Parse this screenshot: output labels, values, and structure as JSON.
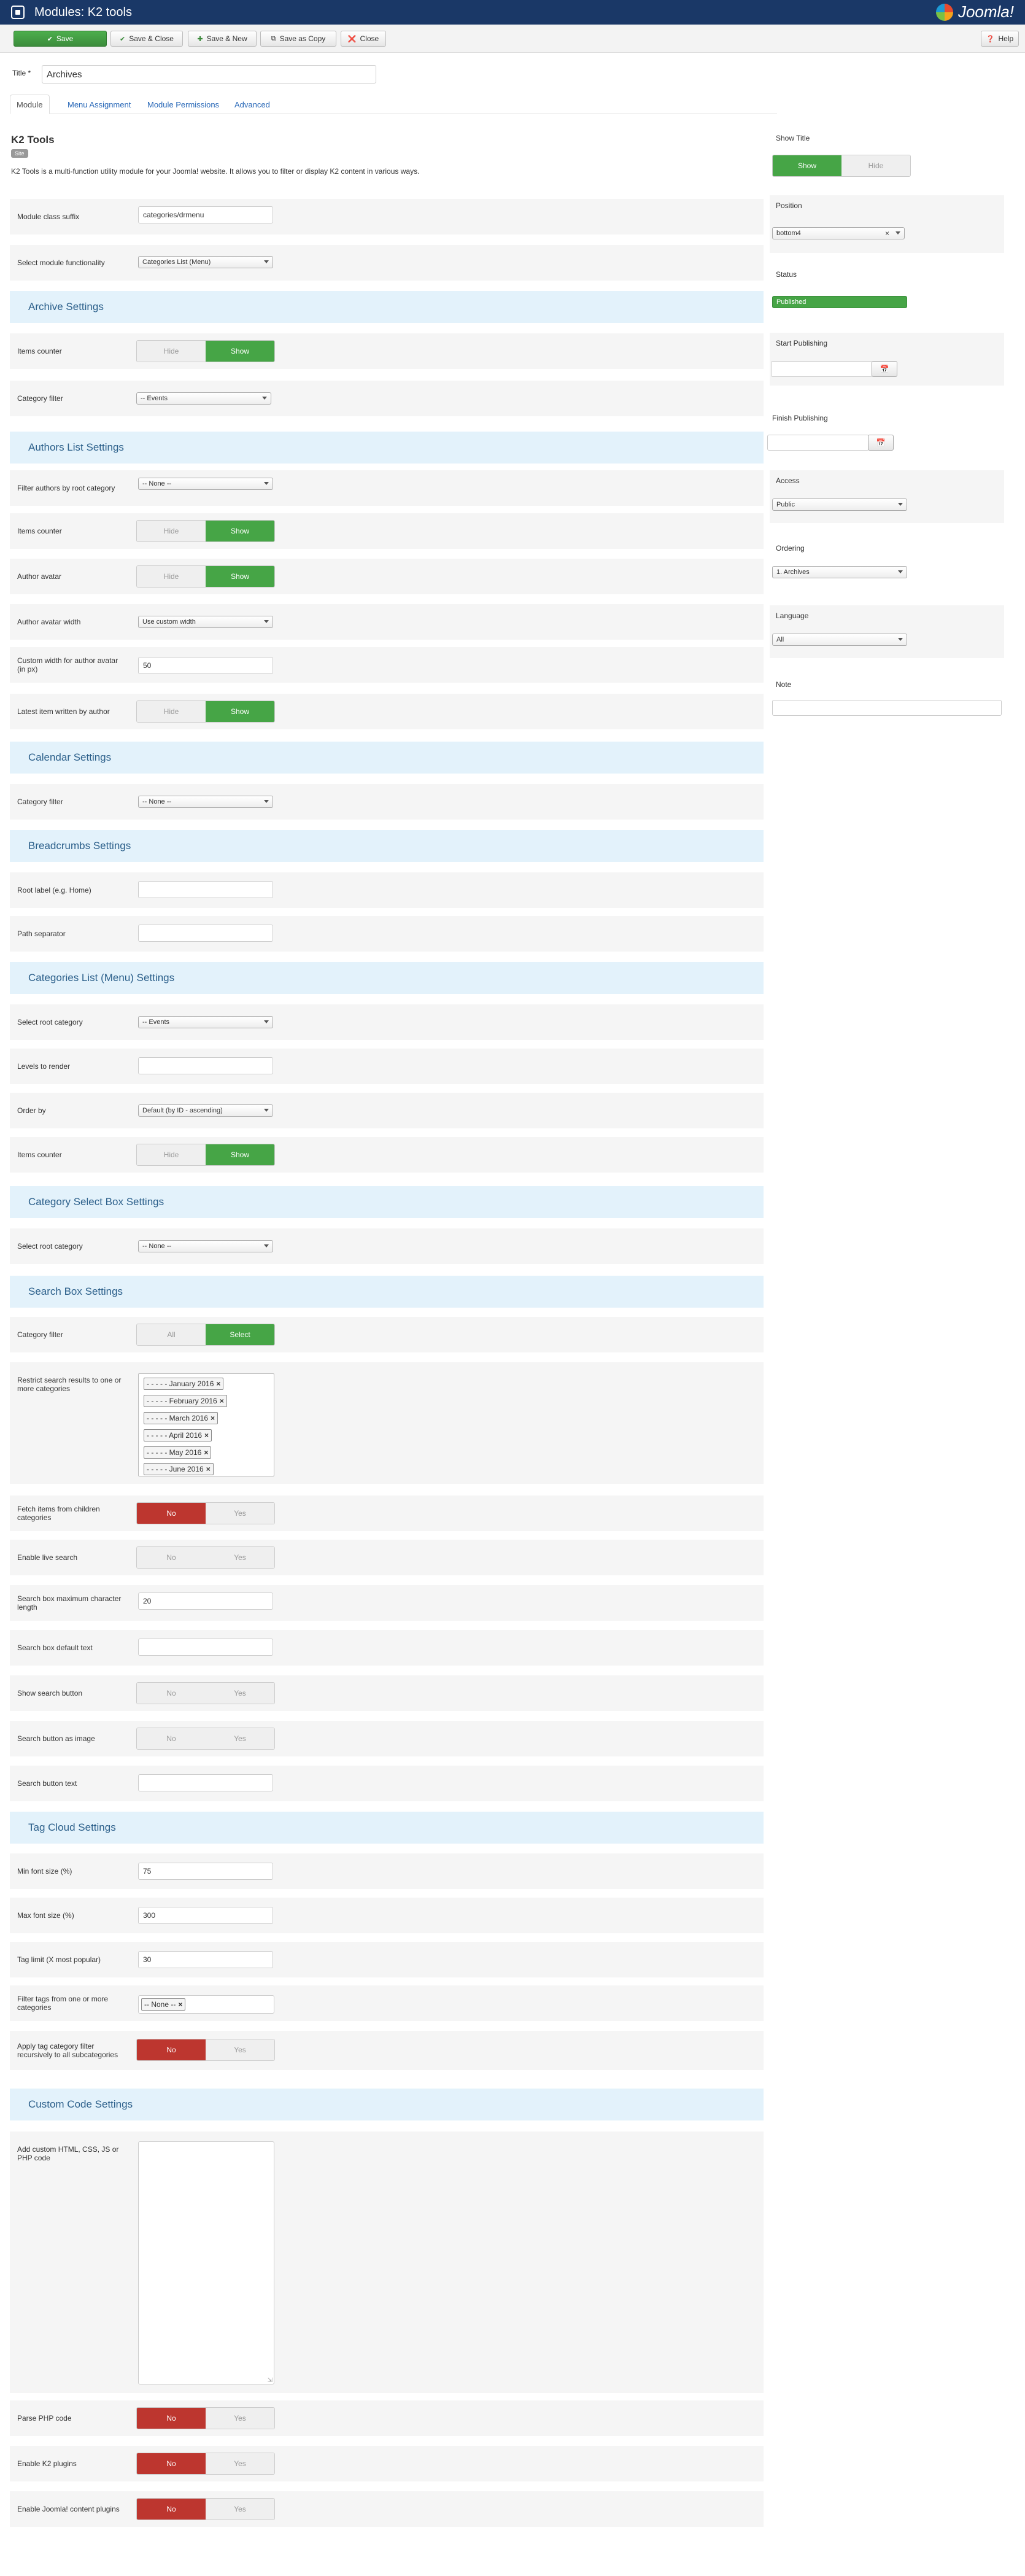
{
  "header": {
    "title": "Modules: K2 tools",
    "logo_text": "Joomla!"
  },
  "toolbar": {
    "save": "Save",
    "save_close": "Save & Close",
    "save_new": "Save & New",
    "save_copy": "Save as Copy",
    "close": "Close",
    "help": "Help"
  },
  "form": {
    "title_label": "Title *",
    "title_value": "Archives"
  },
  "tabs": [
    "Module",
    "Menu Assignment",
    "Module Permissions",
    "Advanced"
  ],
  "module": {
    "name": "K2 Tools",
    "badge": "Site",
    "description": "K2 Tools is a multi-function utility module for your Joomla! website. It allows you to filter or display K2 content in various ways."
  },
  "fields": {
    "class_suffix_label": "Module class suffix",
    "class_suffix_value": "categories/drmenu",
    "functionality_label": "Select module functionality",
    "functionality_value": "Categories List (Menu)"
  },
  "archive": {
    "heading": "Archive Settings",
    "items_counter": "Items counter",
    "category_filter": "Category filter",
    "category_value": "-- Events"
  },
  "authors": {
    "heading": "Authors List Settings",
    "filter_label": "Filter authors by root category",
    "filter_value": "-- None --",
    "items_counter": "Items counter",
    "avatar": "Author avatar",
    "avatar_width": "Author avatar width",
    "avatar_width_value": "Use custom width",
    "custom_width": "Custom width for author avatar (in px)",
    "custom_width_value": "50",
    "latest_item": "Latest item written by author"
  },
  "calendar": {
    "heading": "Calendar Settings",
    "category_filter": "Category filter",
    "category_value": "-- None --"
  },
  "breadcrumbs": {
    "heading": "Breadcrumbs Settings",
    "root_label": "Root label (e.g. Home)",
    "path_sep": "Path separator"
  },
  "catlist": {
    "heading": "Categories List (Menu) Settings",
    "root_label": "Select root category",
    "root_value": "-- Events",
    "levels": "Levels to render",
    "order_label": "Order by",
    "order_value": "Default (by ID - ascending)",
    "items_counter": "Items counter"
  },
  "catselect": {
    "heading": "Category Select Box Settings",
    "root_label": "Select root category",
    "root_value": "-- None --"
  },
  "search": {
    "heading": "Search Box Settings",
    "category_filter": "Category filter",
    "all": "All",
    "select": "Select",
    "restrict_label": "Restrict search results to one or more categories",
    "tags": [
      "- - - - - January 2016",
      "- - - - - February 2016",
      "- - - - - March 2016",
      "- - - - - April 2016",
      "- - - - - May 2016",
      "- - - - - June 2016"
    ],
    "fetch_children": "Fetch items from children categories",
    "live": "Enable live search",
    "max_len": "Search box maximum character length",
    "max_len_value": "20",
    "default_text": "Search box default text",
    "show_button": "Show search button",
    "button_image": "Search button as image",
    "button_text": "Search button text"
  },
  "tagcloud": {
    "heading": "Tag Cloud Settings",
    "min_label": "Min font size (%)",
    "min_value": "75",
    "max_label": "Max font size (%)",
    "max_value": "300",
    "limit_label": "Tag limit (X most popular)",
    "limit_value": "30",
    "filter_label": "Filter tags from one or more categories",
    "filter_tag": "-- None --",
    "apply_label": "Apply tag category filter recursively to all subcategories"
  },
  "custom": {
    "heading": "Custom Code Settings",
    "code_label": "Add custom HTML, CSS, JS or PHP code",
    "parse_php": "Parse PHP code",
    "k2_plugins": "Enable K2 plugins",
    "joomla_plugins": "Enable Joomla! content plugins"
  },
  "toggle": {
    "hide": "Hide",
    "show": "Show",
    "no": "No",
    "yes": "Yes"
  },
  "side": {
    "show_title": "Show Title",
    "position": "Position",
    "position_value": "bottom4",
    "status": "Status",
    "status_value": "Published",
    "start_pub": "Start Publishing",
    "finish_pub": "Finish Publishing",
    "access": "Access",
    "access_value": "Public",
    "ordering": "Ordering",
    "ordering_value": "1. Archives",
    "language": "Language",
    "language_value": "All",
    "note": "Note",
    "cal_icon": "calendar-icon"
  }
}
